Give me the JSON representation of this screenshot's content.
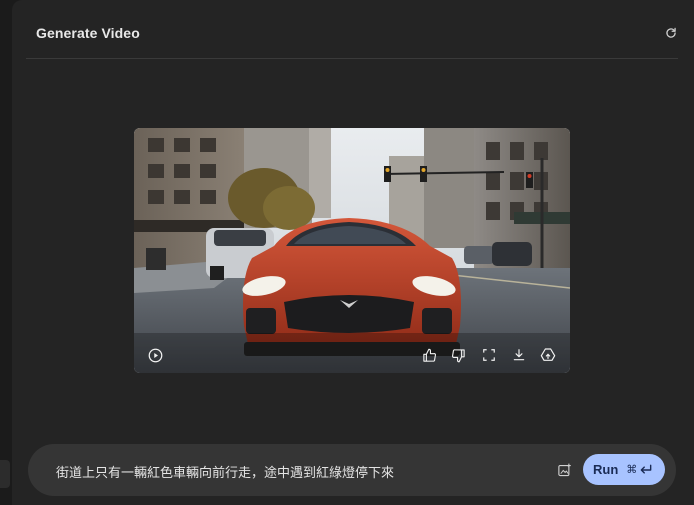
{
  "header": {
    "title": "Generate Video",
    "refresh_icon": "refresh-icon"
  },
  "video": {
    "controls": [
      {
        "name": "play-icon"
      },
      {
        "name": "thumbs-up-icon"
      },
      {
        "name": "thumbs-down-icon"
      },
      {
        "name": "fullscreen-icon"
      },
      {
        "name": "download-icon"
      },
      {
        "name": "drive-upload-icon"
      }
    ]
  },
  "prompt": {
    "text": "街道上只有一輛紅色車輛向前行走，途中遇到紅綠燈停下來",
    "image_icon": "add-image-icon"
  },
  "run": {
    "label": "Run",
    "shortcut": "⌘"
  },
  "colors": {
    "accent": "#a8c3ff",
    "panel": "#242424",
    "prompt_bar": "#353535"
  }
}
